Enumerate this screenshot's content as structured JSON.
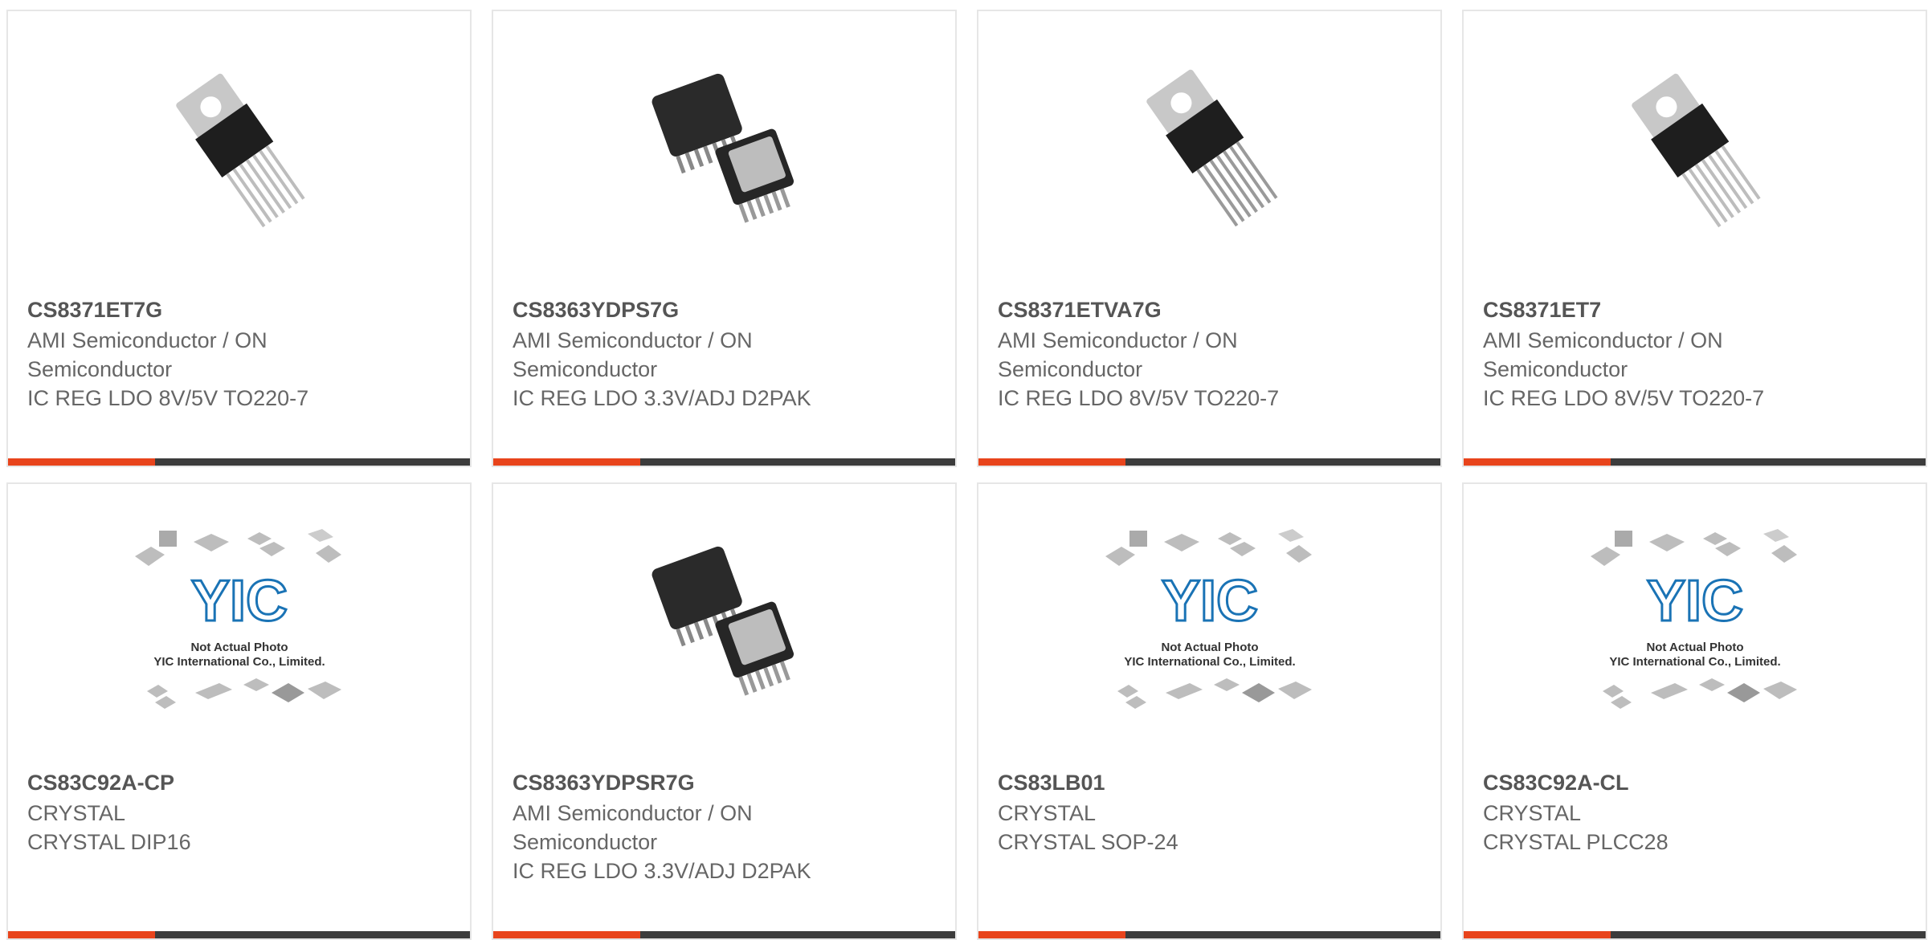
{
  "products": [
    {
      "part": "CS8371ET7G",
      "maker": "AMI Semiconductor / ON Semiconductor",
      "desc": "IC REG LDO 8V/5V TO220-7",
      "image_icon": "to220-7-package-icon"
    },
    {
      "part": "CS8363YDPS7G",
      "maker": "AMI Semiconductor / ON Semiconductor",
      "desc": "IC REG LDO 3.3V/ADJ D2PAK",
      "image_icon": "d2pak-package-icon"
    },
    {
      "part": "CS8371ETVA7G",
      "maker": "AMI Semiconductor / ON Semiconductor",
      "desc": "IC REG LDO 8V/5V TO220-7",
      "image_icon": "to220-7-package-icon"
    },
    {
      "part": "CS8371ET7",
      "maker": "AMI Semiconductor / ON Semiconductor",
      "desc": "IC REG LDO 8V/5V TO220-7",
      "image_icon": "to220-7-package-icon"
    },
    {
      "part": "CS83C92A-CP",
      "maker": "CRYSTAL",
      "desc": "CRYSTAL DIP16",
      "image_icon": "placeholder-logo-icon"
    },
    {
      "part": "CS8363YDPSR7G",
      "maker": "AMI Semiconductor / ON Semiconductor",
      "desc": "IC REG LDO 3.3V/ADJ D2PAK",
      "image_icon": "d2pak-package-icon"
    },
    {
      "part": "CS83LB01",
      "maker": "CRYSTAL",
      "desc": "CRYSTAL SOP-24",
      "image_icon": "placeholder-logo-icon"
    },
    {
      "part": "CS83C92A-CL",
      "maker": "CRYSTAL",
      "desc": "CRYSTAL PLCC28",
      "image_icon": "placeholder-logo-icon"
    }
  ],
  "placeholder": {
    "logo_text": "YIC",
    "line1": "Not Actual Photo",
    "line2": "YIC International Co., Limited."
  },
  "colors": {
    "accent": "#e8441c",
    "bar": "#3c3c3c",
    "logo_blue": "#1a73b5"
  }
}
